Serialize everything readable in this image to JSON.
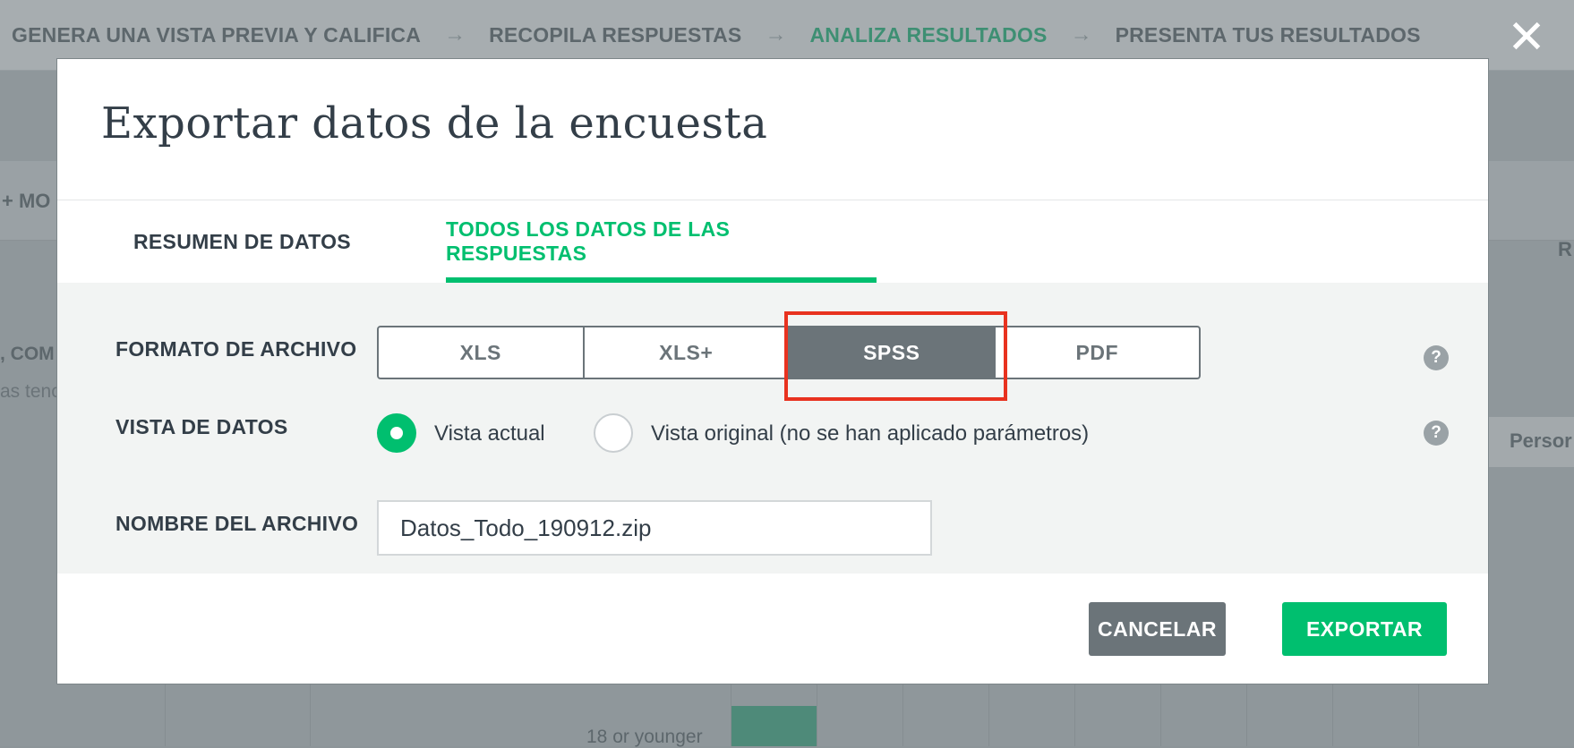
{
  "background": {
    "steps": [
      {
        "label": "GENERA UNA VISTA PREVIA Y CALIFICA"
      },
      {
        "label": "RECOPILA RESPUESTAS"
      },
      {
        "label": "ANALIZA RESULTADOS",
        "active": true
      },
      {
        "label": "PRESENTA TUS RESULTADOS"
      }
    ],
    "fragments": {
      "mo": "+ MO",
      "com": ", COM",
      "tenc": "as tenc",
      "r": "R",
      "person": "Persor",
      "young": "18 or younger"
    }
  },
  "close_label": "✕",
  "modal": {
    "title": "Exportar datos de la encuesta",
    "tabs": [
      {
        "label": "RESUMEN DE DATOS",
        "active": false
      },
      {
        "label": "TODOS LOS DATOS DE LAS RESPUESTAS",
        "active": true
      }
    ],
    "format": {
      "label": "FORMATO DE ARCHIVO",
      "options": [
        "XLS",
        "XLS+",
        "SPSS",
        "PDF"
      ],
      "selected": "SPSS"
    },
    "view": {
      "label": "VISTA DE DATOS",
      "options": [
        {
          "label": "Vista actual",
          "checked": true
        },
        {
          "label": "Vista original (no se han aplicado parámetros)",
          "checked": false
        }
      ]
    },
    "filename": {
      "label": "NOMBRE DEL ARCHIVO",
      "value": "Datos_Todo_190912.zip"
    },
    "help_icon": "?",
    "buttons": {
      "cancel": "CANCELAR",
      "export": "EXPORTAR"
    }
  },
  "colors": {
    "accent": "#00bf6f",
    "selected_segment": "#6b7479",
    "highlight": "#e8321f",
    "text": "#333e48"
  }
}
